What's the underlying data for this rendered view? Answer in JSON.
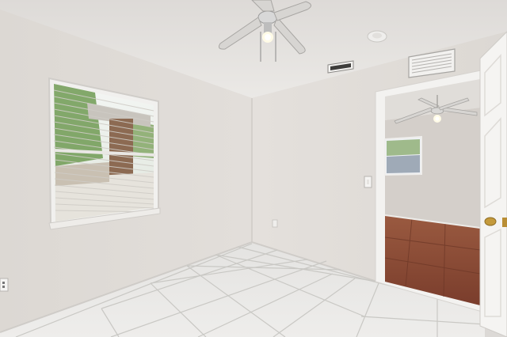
{
  "scene": {
    "kind": "photo",
    "room": "empty bedroom",
    "colors": {
      "ceiling": "#e8e6e3",
      "left_wall": "#dedad6",
      "back_wall": "#e2ded9",
      "floor_tile": "#e9e8e6",
      "grout": "#c9c8c4",
      "door": "#f4f3f1",
      "next_room_wall": "#d4cfca",
      "next_room_floor": "#8a4a35",
      "window_view_green": "#6f9a52",
      "door_knob": "#c49a3c"
    },
    "icons": [
      "ceiling-fan-icon",
      "smoke-detector-icon",
      "air-vent-icon",
      "window-blinds-icon",
      "light-switch-icon",
      "electrical-outlet-icon",
      "door-knob-icon"
    ]
  }
}
